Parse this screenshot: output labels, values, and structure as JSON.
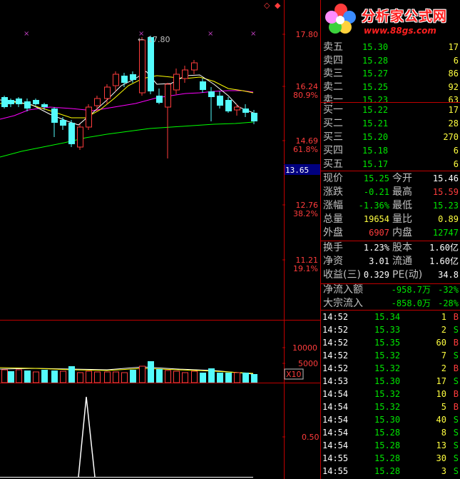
{
  "chart": {
    "price_labels": [
      {
        "value": "17.80",
        "pct": ""
      },
      {
        "value": "16.24",
        "pct": "80.9%"
      },
      {
        "value": "14.69",
        "pct": "61.8%"
      },
      {
        "value": "12.76",
        "pct": "38.2%"
      },
      {
        "value": "11.21",
        "pct": "19.1%"
      }
    ],
    "current_price_tag": "13.65",
    "high_annotation": "17.80",
    "volume_labels": [
      "10000",
      "5000"
    ],
    "volume_unit": "X10",
    "indicator_label": "0.50",
    "colors": {
      "up": "#ff3c3c",
      "down": "#54fcfc",
      "ma5": "#ffffff",
      "ma10": "#ffff00",
      "ma20": "#ff00ff",
      "ma60": "#00ff00",
      "grid": "#c00000"
    }
  },
  "logo": {
    "title": "分析家公式网",
    "url": "www.88gs.com"
  },
  "order_book": {
    "asks": [
      {
        "label": "卖五",
        "price": "15.30",
        "vol": "17"
      },
      {
        "label": "卖四",
        "price": "15.28",
        "vol": "6"
      },
      {
        "label": "卖三",
        "price": "15.27",
        "vol": "86"
      },
      {
        "label": "卖二",
        "price": "15.25",
        "vol": "92"
      },
      {
        "label": "卖一",
        "price": "15.23",
        "vol": "63"
      }
    ],
    "bids": [
      {
        "label": "买一",
        "price": "15.22",
        "vol": "17"
      },
      {
        "label": "买二",
        "price": "15.21",
        "vol": "28"
      },
      {
        "label": "买三",
        "price": "15.20",
        "vol": "270"
      },
      {
        "label": "买四",
        "price": "15.18",
        "vol": "6"
      },
      {
        "label": "买五",
        "price": "15.17",
        "vol": "6"
      }
    ]
  },
  "quote": [
    {
      "l1": "现价",
      "v1": "15.25",
      "c1": "g",
      "l2": "今开",
      "v2": "15.46",
      "c2": "w"
    },
    {
      "l1": "涨跌",
      "v1": "-0.21",
      "c1": "g",
      "l2": "最高",
      "v2": "15.59",
      "c2": "r"
    },
    {
      "l1": "涨幅",
      "v1": "-1.36%",
      "c1": "g",
      "l2": "最低",
      "v2": "15.23",
      "c2": "g"
    },
    {
      "l1": "总量",
      "v1": "19654",
      "c1": "y",
      "l2": "量比",
      "v2": "0.89",
      "c2": "y"
    },
    {
      "l1": "外盘",
      "v1": "6907",
      "c1": "r",
      "l2": "内盘",
      "v2": "12747",
      "c2": "g"
    }
  ],
  "finance": [
    {
      "l1": "换手",
      "v1": "1.23%",
      "l2": "股本",
      "v2": "1.60亿"
    },
    {
      "l1": "净资",
      "v1": "3.01",
      "l2": "流通",
      "v2": "1.60亿"
    },
    {
      "l1": "收益(三)",
      "v1": "0.329",
      "l2": "PE(动)",
      "v2": "34.8"
    }
  ],
  "flows": [
    {
      "label": "净流入额",
      "value": "-958.7万",
      "pct": "-32%"
    },
    {
      "label": "大宗流入",
      "value": "-858.0万",
      "pct": "-28%"
    }
  ],
  "ticks": [
    {
      "time": "14:52",
      "price": "15.34",
      "vol": "1",
      "side": "B"
    },
    {
      "time": "14:52",
      "price": "15.33",
      "vol": "2",
      "side": "S"
    },
    {
      "time": "14:52",
      "price": "15.35",
      "vol": "60",
      "side": "B"
    },
    {
      "time": "14:52",
      "price": "15.32",
      "vol": "7",
      "side": "S"
    },
    {
      "time": "14:52",
      "price": "15.32",
      "vol": "2",
      "side": "B"
    },
    {
      "time": "14:53",
      "price": "15.30",
      "vol": "17",
      "side": "S"
    },
    {
      "time": "14:54",
      "price": "15.32",
      "vol": "10",
      "side": "B"
    },
    {
      "time": "14:54",
      "price": "15.32",
      "vol": "5",
      "side": "B"
    },
    {
      "time": "14:54",
      "price": "15.30",
      "vol": "40",
      "side": "S"
    },
    {
      "time": "14:54",
      "price": "15.28",
      "vol": "8",
      "side": "S"
    },
    {
      "time": "14:54",
      "price": "15.28",
      "vol": "13",
      "side": "S"
    },
    {
      "time": "14:55",
      "price": "15.28",
      "vol": "30",
      "side": "S"
    },
    {
      "time": "14:55",
      "price": "15.28",
      "vol": "3",
      "side": "S"
    }
  ]
}
